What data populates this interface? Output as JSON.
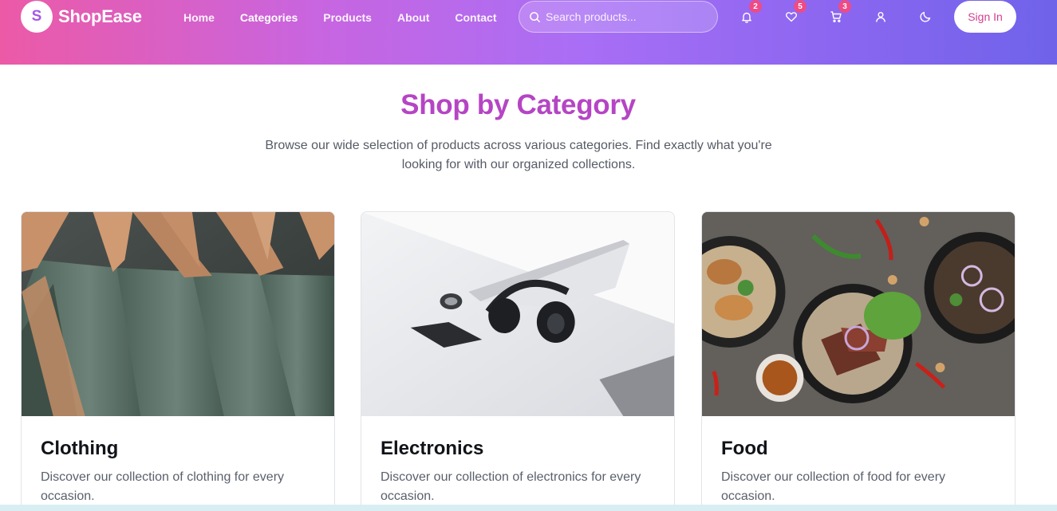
{
  "brand": {
    "logo_letter": "S",
    "name": "ShopEase"
  },
  "nav": {
    "items": [
      {
        "label": "Home"
      },
      {
        "label": "Categories"
      },
      {
        "label": "Products"
      },
      {
        "label": "About"
      },
      {
        "label": "Contact"
      }
    ]
  },
  "search": {
    "placeholder": "Search products...",
    "value": ""
  },
  "header_icons": {
    "notifications": {
      "icon": "bell-icon",
      "count": "2"
    },
    "wishlist": {
      "icon": "heart-icon",
      "count": "5"
    },
    "cart": {
      "icon": "cart-icon",
      "count": "3"
    },
    "account": {
      "icon": "user-icon"
    },
    "theme": {
      "icon": "moon-icon"
    }
  },
  "signin_label": "Sign In",
  "hero": {
    "title": "Shop by Category",
    "subtitle": "Browse our wide selection of products across various categories. Find exactly what you're looking for with our organized collections."
  },
  "categories": [
    {
      "name": "Clothing",
      "description": "Discover our collection of clothing for every occasion."
    },
    {
      "name": "Electronics",
      "description": "Discover our collection of electronics for every occasion."
    },
    {
      "name": "Food",
      "description": "Discover our collection of food for every occasion."
    }
  ],
  "colors": {
    "header_gradient": [
      "#ec5aa6",
      "#a96ef5",
      "#6f63ea"
    ],
    "title": "#b545c4",
    "badge": "#ee4b86",
    "signin_text": "#d23f8f"
  }
}
